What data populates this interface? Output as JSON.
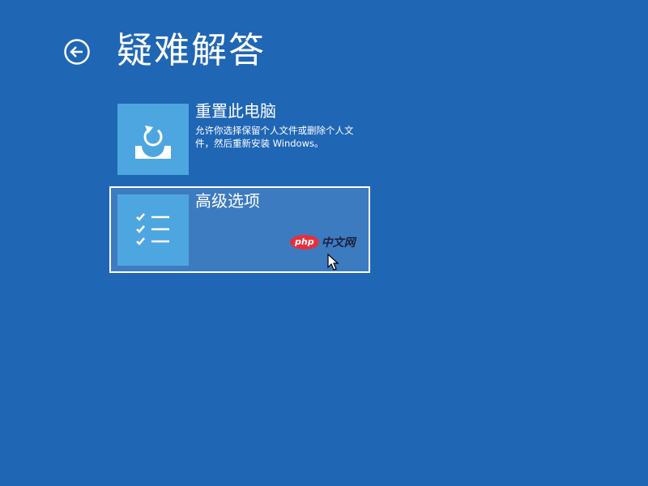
{
  "page": {
    "title": "疑难解答",
    "background_color": "#1f66b5"
  },
  "back": {
    "icon": "back-arrow-icon"
  },
  "options": [
    {
      "title": "重置此电脑",
      "description": "允许你选择保留个人文件或删除个人文件，然后重新安装 Windows。",
      "icon": "reset-pc-icon",
      "selected": false
    },
    {
      "title": "高级选项",
      "description": "",
      "icon": "checklist-icon",
      "selected": true
    }
  ],
  "watermark": {
    "badge": "php",
    "text": "中文网"
  },
  "colors": {
    "tile": "#4da6e0",
    "selected_background": "#3d7bc1",
    "watermark_red": "#e5303c"
  }
}
